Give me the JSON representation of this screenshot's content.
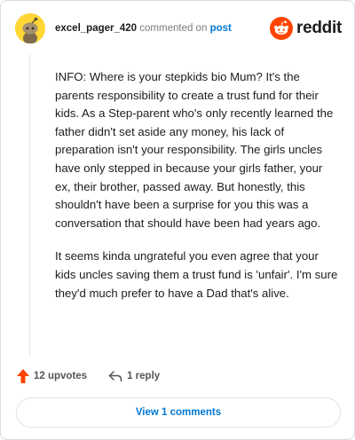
{
  "comment": {
    "username": "excel_pager_420",
    "action_text": "commented on",
    "post_link": "post",
    "paragraphs": [
      "INFO: Where is your stepkids bio Mum? It's the parents responsibility to create a trust fund for their kids. As a Step-parent who's only recently learned the father didn't set aside any money, his lack of preparation isn't your responsibility. The girls uncles have only stepped in because your girls father, your ex, their brother, passed away. But honestly, this shouldn't have been a surprise for you this was a conversation that should have been had years ago.",
      "It seems kinda ungrateful you even agree that your kids uncles saving them a trust fund is 'unfair'. I'm sure they'd much prefer to have a Dad that's alive."
    ],
    "upvotes": "12 upvotes",
    "replies": "1 reply",
    "view_comments": "View 1 comments"
  },
  "brand": {
    "name": "reddit"
  },
  "colors": {
    "accent_orange": "#ff4500",
    "link_blue": "#0079d3",
    "avatar_yellow": "#ffd635"
  },
  "icons": {
    "avatar": "snoo-avatar-icon",
    "logo": "reddit-logo-icon",
    "upvote": "upvote-arrow-icon",
    "reply": "reply-arrow-icon"
  }
}
